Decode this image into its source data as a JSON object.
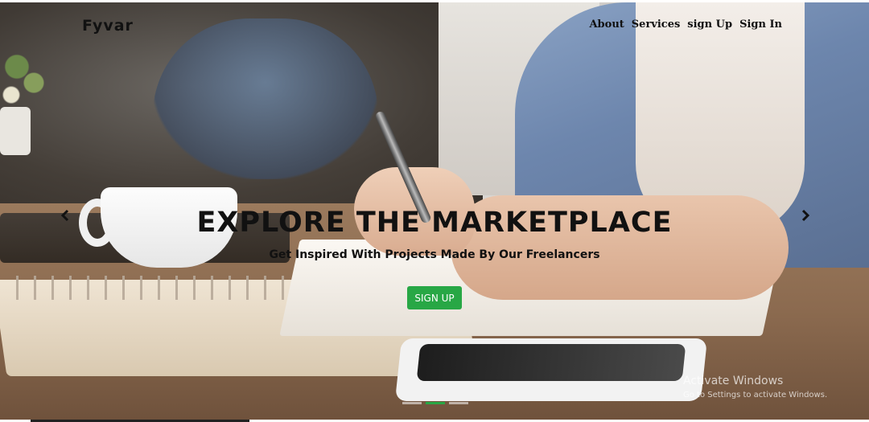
{
  "brand": "Fyvar",
  "nav": {
    "items": [
      "About",
      "Services",
      "sign Up",
      "Sign In"
    ]
  },
  "hero": {
    "headline": "EXPLORE THE MARKETPLACE",
    "subheadline": "Get Inspired With Projects Made By Our Freelancers",
    "cta_label": "SIGN UP"
  },
  "carousel": {
    "slide_count": 3,
    "active_index": 1,
    "prev_icon": "chevron-left-icon",
    "next_icon": "chevron-right-icon"
  },
  "watermark": {
    "title": "Activate Windows",
    "subtitle": "Go to Settings to activate Windows."
  },
  "colors": {
    "accent": "#28a745",
    "text": "#111111"
  }
}
